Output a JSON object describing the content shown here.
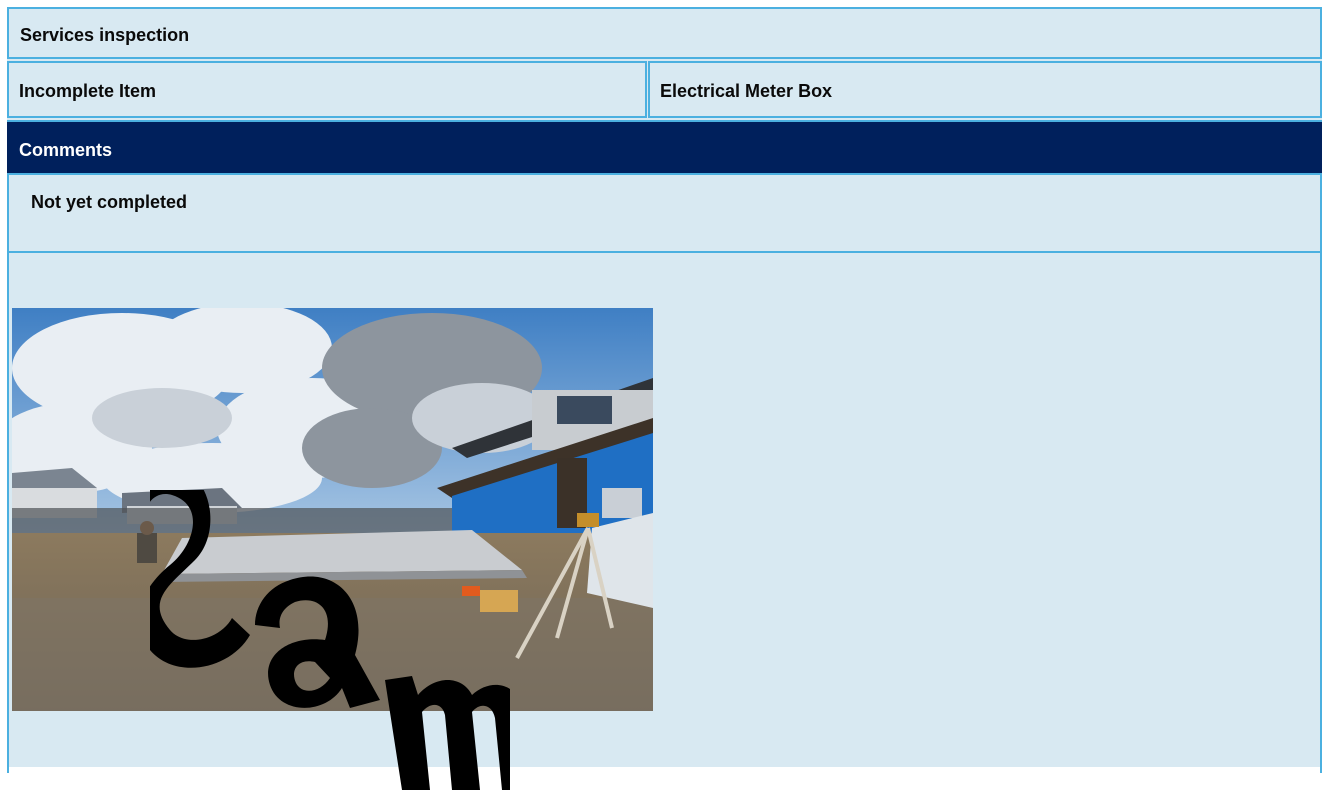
{
  "section": {
    "title": "Services inspection"
  },
  "item": {
    "label": "Incomplete Item",
    "value": "Electrical Meter Box"
  },
  "comments": {
    "heading": "Comments",
    "text": "Not yet completed"
  },
  "photo": {
    "subject": "construction-site-photo"
  },
  "watermark": {
    "text": "Sample"
  },
  "colors": {
    "panel_bg": "#d8e9f2",
    "border": "#4bb0e0",
    "header_bg": "#00205c"
  }
}
